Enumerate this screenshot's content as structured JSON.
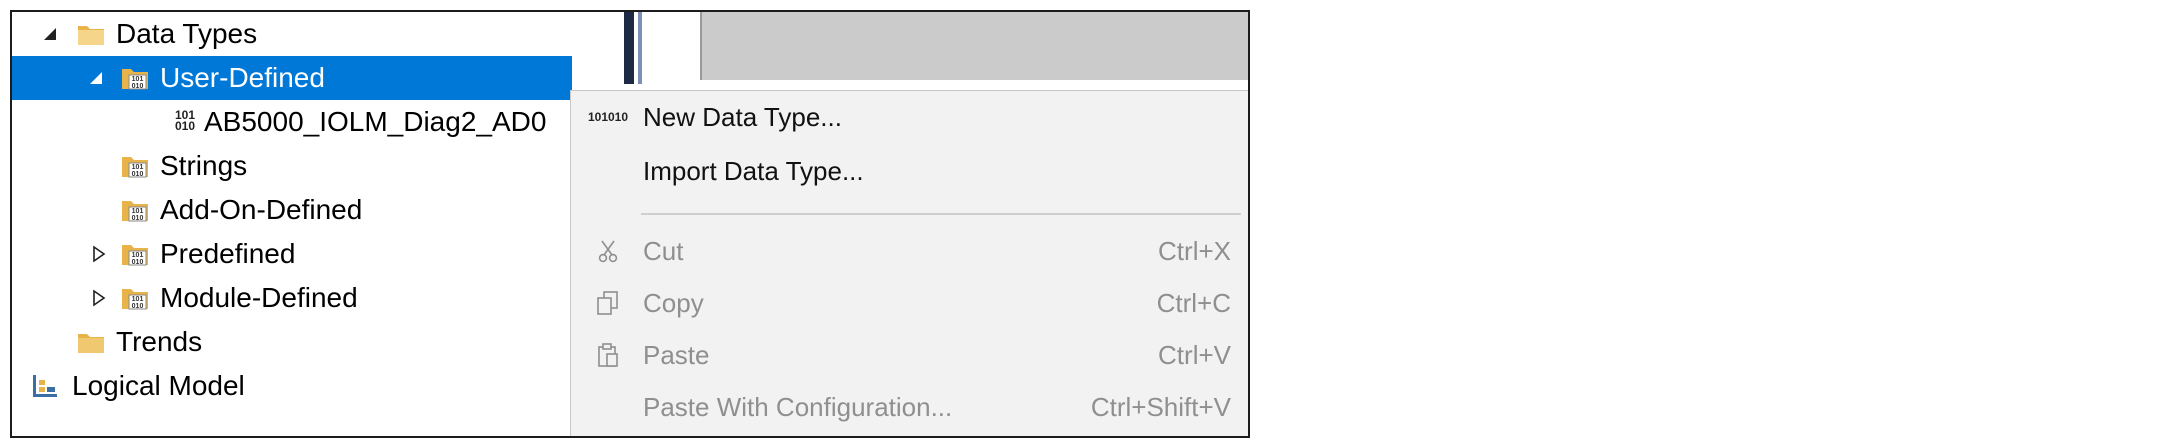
{
  "tree": {
    "items": [
      {
        "label": "Data Types",
        "expanded": true,
        "icon": "folder-icon"
      },
      {
        "label": "User-Defined",
        "expanded": true,
        "selected": true,
        "icon": "datatype-folder-icon"
      },
      {
        "label": "AB5000_IOLM_Diag2_AD0",
        "icon": "binary-datatype-icon"
      },
      {
        "label": "Strings",
        "icon": "datatype-folder-icon"
      },
      {
        "label": "Add-On-Defined",
        "icon": "datatype-folder-icon"
      },
      {
        "label": "Predefined",
        "expanded": false,
        "icon": "datatype-folder-icon"
      },
      {
        "label": "Module-Defined",
        "expanded": false,
        "icon": "datatype-folder-icon"
      },
      {
        "label": "Trends",
        "icon": "folder-icon"
      },
      {
        "label": "Logical Model",
        "icon": "logical-model-icon"
      }
    ]
  },
  "context_menu": {
    "items": [
      {
        "label": "New Data Type...",
        "shortcut": "",
        "enabled": true,
        "icon": "binary-datatype-icon"
      },
      {
        "label": "Import Data Type...",
        "shortcut": "",
        "enabled": true,
        "icon": ""
      },
      {
        "label": "Cut",
        "shortcut": "Ctrl+X",
        "enabled": false,
        "icon": "scissors-icon"
      },
      {
        "label": "Copy",
        "shortcut": "Ctrl+C",
        "enabled": false,
        "icon": "copy-icon"
      },
      {
        "label": "Paste",
        "shortcut": "Ctrl+V",
        "enabled": false,
        "icon": "paste-icon"
      },
      {
        "label": "Paste With Configuration...",
        "shortcut": "Ctrl+Shift+V",
        "enabled": false,
        "icon": ""
      }
    ]
  },
  "binary_glyph": {
    "top": "101",
    "bottom": "010"
  },
  "colors": {
    "selection": "#0078d7",
    "menu_bg": "#f2f2f2",
    "disabled_text": "#8f8f8f",
    "folder": "#e8b44a"
  }
}
